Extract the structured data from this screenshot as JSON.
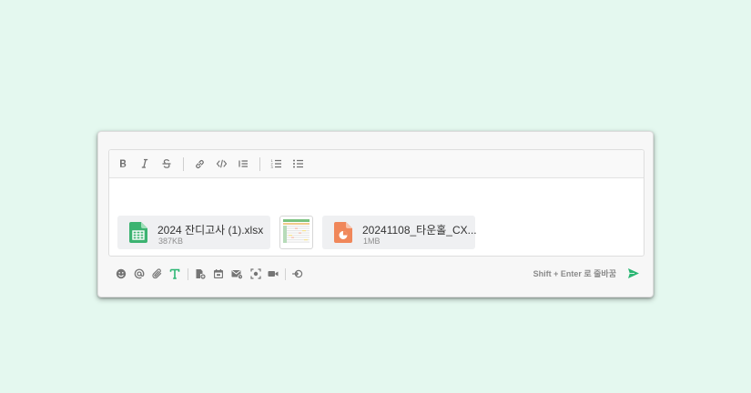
{
  "toolbar": {
    "buttons": [
      {
        "name": "bold",
        "icon": "bold-icon"
      },
      {
        "name": "italic",
        "icon": "italic-icon"
      },
      {
        "name": "strikethrough",
        "icon": "strikethrough-icon"
      },
      {
        "name": "link",
        "icon": "link-icon"
      },
      {
        "name": "code",
        "icon": "code-icon"
      },
      {
        "name": "blockquote",
        "icon": "blockquote-icon"
      },
      {
        "name": "ordered-list",
        "icon": "ordered-list-icon"
      },
      {
        "name": "bullet-list",
        "icon": "bullet-list-icon"
      }
    ]
  },
  "attachments": [
    {
      "name": "2024 잔디고사 (1).xlsx",
      "size": "387KB",
      "icon": "spreadsheet-file-icon",
      "color": "#3cb371"
    },
    {
      "name": "20241108_타운홀_CX...",
      "size": "1MB",
      "icon": "presentation-file-icon",
      "color": "#f0875a"
    }
  ],
  "image_thumbnail": {
    "icon": "image-thumbnail"
  },
  "bottom_toolbar": {
    "buttons": [
      "emoji-icon",
      "mention-icon",
      "attach-icon",
      "text-format-icon",
      "file-add-icon",
      "calendar-icon",
      "email-icon",
      "screenshot-icon",
      "video-icon",
      "integration-icon"
    ],
    "hint": "Shift + Enter 로 줄바꿈",
    "send_color": "#2bb673"
  },
  "colors": {
    "background": "#e4f8ef",
    "accent": "#2bb673"
  }
}
